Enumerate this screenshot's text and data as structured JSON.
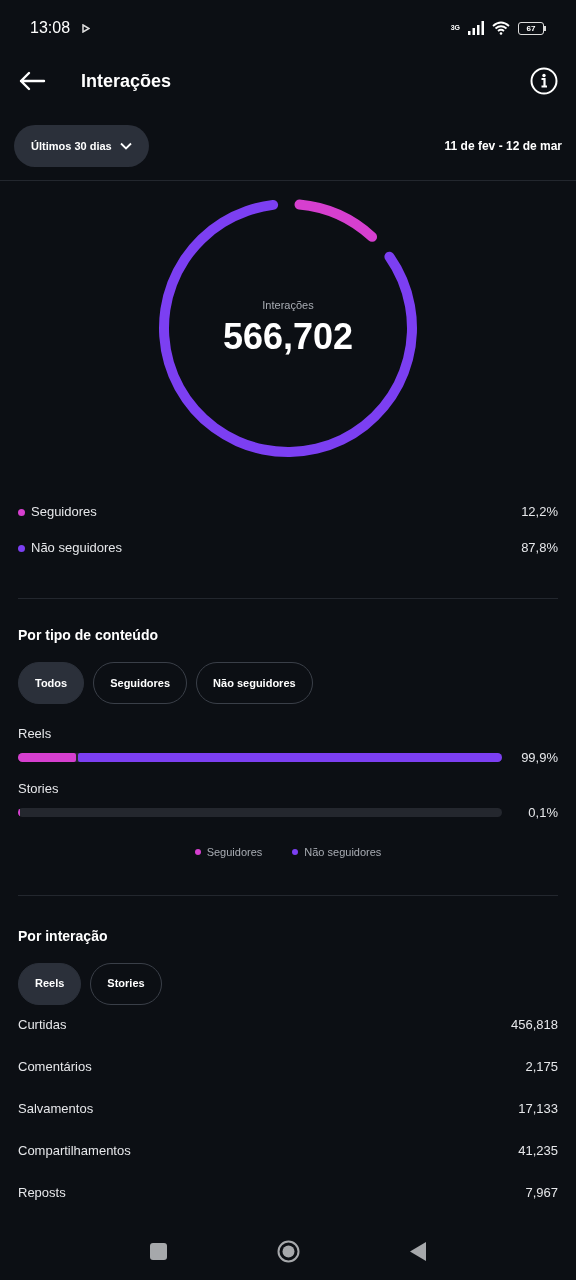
{
  "status_bar": {
    "time": "13:08",
    "network": "3G",
    "battery": "67"
  },
  "header": {
    "title": "Interações"
  },
  "filter": {
    "period": "Últimos 30 dias",
    "range": "11 de fev - 12 de mar"
  },
  "summary": {
    "label": "Interações",
    "total": "566,702",
    "chart_data": {
      "type": "donut",
      "categories": [
        "Seguidores",
        "Não seguidores"
      ],
      "values": [
        12.2,
        87.8
      ],
      "colors": [
        "#d63fcf",
        "#7c3ff2"
      ]
    },
    "legend_values": [
      "12,2%",
      "87,8%"
    ]
  },
  "content_type": {
    "title": "Por tipo de conteúdo",
    "tabs": [
      {
        "label": "Todos",
        "selected": true
      },
      {
        "label": "Seguidores",
        "selected": false
      },
      {
        "label": "Não seguidores",
        "selected": false
      }
    ],
    "rows": [
      {
        "label": "Reels",
        "value": "99,9%",
        "segments": [
          {
            "color": "#d63fcf",
            "level": 0.12
          },
          {
            "color": "#7c3ff2",
            "level": 0.879
          }
        ]
      },
      {
        "label": "Stories",
        "value": "0,1%",
        "segments": [
          {
            "color": "#d63fcf",
            "level": 0.001
          }
        ]
      }
    ],
    "legend": [
      {
        "label": "Seguidores",
        "color": "#d63fcf"
      },
      {
        "label": "Não seguidores",
        "color": "#7c3ff2"
      }
    ]
  },
  "by_interaction": {
    "title": "Por interação",
    "tabs": [
      {
        "label": "Reels",
        "selected": true
      },
      {
        "label": "Stories",
        "selected": false
      }
    ],
    "rows": [
      {
        "label": "Curtidas",
        "value": "456,818"
      },
      {
        "label": "Comentários",
        "value": "2,175"
      },
      {
        "label": "Salvamentos",
        "value": "17,133"
      },
      {
        "label": "Compartilhamentos",
        "value": "41,235"
      },
      {
        "label": "Reposts",
        "value": "7,967"
      }
    ]
  }
}
